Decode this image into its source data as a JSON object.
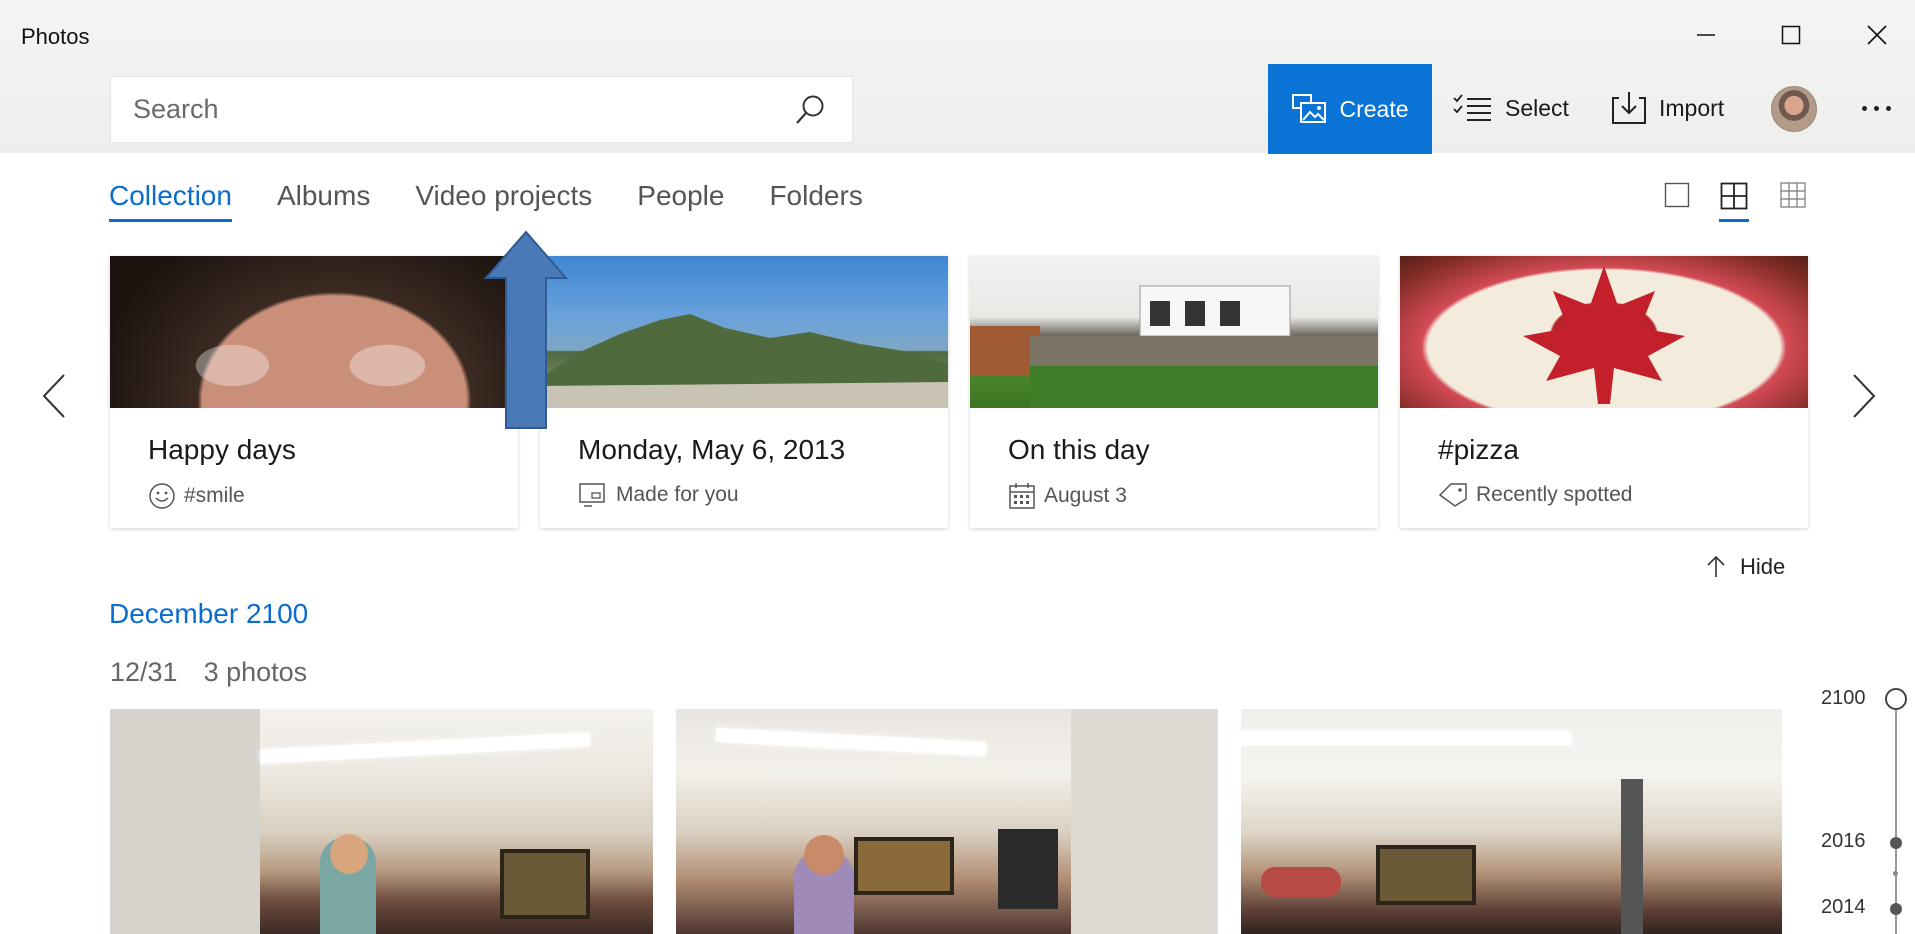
{
  "app": {
    "title": "Photos"
  },
  "search": {
    "placeholder": "Search"
  },
  "toolbar": {
    "create_label": "Create",
    "select_label": "Select",
    "import_label": "Import",
    "accent_color": "#0a74d6"
  },
  "tabs": [
    {
      "label": "Collection",
      "active": true
    },
    {
      "label": "Albums",
      "active": false
    },
    {
      "label": "Video projects",
      "active": false
    },
    {
      "label": "People",
      "active": false
    },
    {
      "label": "Folders",
      "active": false
    }
  ],
  "view_modes": [
    {
      "icon": "single-square-icon",
      "active": false
    },
    {
      "icon": "four-grid-icon",
      "active": true
    },
    {
      "icon": "nine-grid-icon",
      "active": false
    }
  ],
  "cards": [
    {
      "title": "Happy days",
      "subtitle": "#smile",
      "icon": "smiley-icon"
    },
    {
      "title": "Monday, May 6, 2013",
      "subtitle": "Made for you",
      "icon": "slideshow-icon"
    },
    {
      "title": "On this day",
      "subtitle": "August 3",
      "icon": "calendar-icon"
    },
    {
      "title": "#pizza",
      "subtitle": "Recently spotted",
      "icon": "tag-icon"
    }
  ],
  "hide": {
    "label": "Hide"
  },
  "section": {
    "month": "December 2100",
    "date": "12/31",
    "count": "3 photos"
  },
  "timeline": {
    "years": [
      "2100",
      "2016",
      "2014"
    ]
  }
}
